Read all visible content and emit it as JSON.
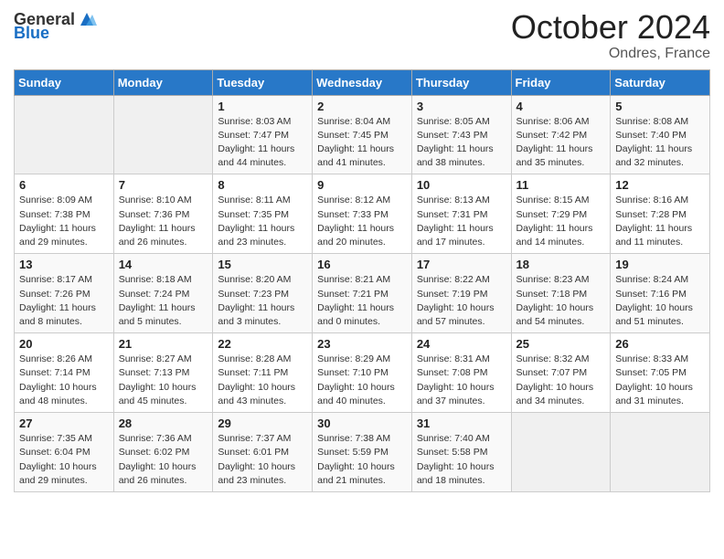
{
  "header": {
    "logo": {
      "general": "General",
      "blue": "Blue"
    },
    "month": "October 2024",
    "location": "Ondres, France"
  },
  "days_of_week": [
    "Sunday",
    "Monday",
    "Tuesday",
    "Wednesday",
    "Thursday",
    "Friday",
    "Saturday"
  ],
  "weeks": [
    [
      {
        "day": "",
        "info": ""
      },
      {
        "day": "",
        "info": ""
      },
      {
        "day": "1",
        "info": "Sunrise: 8:03 AM\nSunset: 7:47 PM\nDaylight: 11 hours and 44 minutes."
      },
      {
        "day": "2",
        "info": "Sunrise: 8:04 AM\nSunset: 7:45 PM\nDaylight: 11 hours and 41 minutes."
      },
      {
        "day": "3",
        "info": "Sunrise: 8:05 AM\nSunset: 7:43 PM\nDaylight: 11 hours and 38 minutes."
      },
      {
        "day": "4",
        "info": "Sunrise: 8:06 AM\nSunset: 7:42 PM\nDaylight: 11 hours and 35 minutes."
      },
      {
        "day": "5",
        "info": "Sunrise: 8:08 AM\nSunset: 7:40 PM\nDaylight: 11 hours and 32 minutes."
      }
    ],
    [
      {
        "day": "6",
        "info": "Sunrise: 8:09 AM\nSunset: 7:38 PM\nDaylight: 11 hours and 29 minutes."
      },
      {
        "day": "7",
        "info": "Sunrise: 8:10 AM\nSunset: 7:36 PM\nDaylight: 11 hours and 26 minutes."
      },
      {
        "day": "8",
        "info": "Sunrise: 8:11 AM\nSunset: 7:35 PM\nDaylight: 11 hours and 23 minutes."
      },
      {
        "day": "9",
        "info": "Sunrise: 8:12 AM\nSunset: 7:33 PM\nDaylight: 11 hours and 20 minutes."
      },
      {
        "day": "10",
        "info": "Sunrise: 8:13 AM\nSunset: 7:31 PM\nDaylight: 11 hours and 17 minutes."
      },
      {
        "day": "11",
        "info": "Sunrise: 8:15 AM\nSunset: 7:29 PM\nDaylight: 11 hours and 14 minutes."
      },
      {
        "day": "12",
        "info": "Sunrise: 8:16 AM\nSunset: 7:28 PM\nDaylight: 11 hours and 11 minutes."
      }
    ],
    [
      {
        "day": "13",
        "info": "Sunrise: 8:17 AM\nSunset: 7:26 PM\nDaylight: 11 hours and 8 minutes."
      },
      {
        "day": "14",
        "info": "Sunrise: 8:18 AM\nSunset: 7:24 PM\nDaylight: 11 hours and 5 minutes."
      },
      {
        "day": "15",
        "info": "Sunrise: 8:20 AM\nSunset: 7:23 PM\nDaylight: 11 hours and 3 minutes."
      },
      {
        "day": "16",
        "info": "Sunrise: 8:21 AM\nSunset: 7:21 PM\nDaylight: 11 hours and 0 minutes."
      },
      {
        "day": "17",
        "info": "Sunrise: 8:22 AM\nSunset: 7:19 PM\nDaylight: 10 hours and 57 minutes."
      },
      {
        "day": "18",
        "info": "Sunrise: 8:23 AM\nSunset: 7:18 PM\nDaylight: 10 hours and 54 minutes."
      },
      {
        "day": "19",
        "info": "Sunrise: 8:24 AM\nSunset: 7:16 PM\nDaylight: 10 hours and 51 minutes."
      }
    ],
    [
      {
        "day": "20",
        "info": "Sunrise: 8:26 AM\nSunset: 7:14 PM\nDaylight: 10 hours and 48 minutes."
      },
      {
        "day": "21",
        "info": "Sunrise: 8:27 AM\nSunset: 7:13 PM\nDaylight: 10 hours and 45 minutes."
      },
      {
        "day": "22",
        "info": "Sunrise: 8:28 AM\nSunset: 7:11 PM\nDaylight: 10 hours and 43 minutes."
      },
      {
        "day": "23",
        "info": "Sunrise: 8:29 AM\nSunset: 7:10 PM\nDaylight: 10 hours and 40 minutes."
      },
      {
        "day": "24",
        "info": "Sunrise: 8:31 AM\nSunset: 7:08 PM\nDaylight: 10 hours and 37 minutes."
      },
      {
        "day": "25",
        "info": "Sunrise: 8:32 AM\nSunset: 7:07 PM\nDaylight: 10 hours and 34 minutes."
      },
      {
        "day": "26",
        "info": "Sunrise: 8:33 AM\nSunset: 7:05 PM\nDaylight: 10 hours and 31 minutes."
      }
    ],
    [
      {
        "day": "27",
        "info": "Sunrise: 7:35 AM\nSunset: 6:04 PM\nDaylight: 10 hours and 29 minutes."
      },
      {
        "day": "28",
        "info": "Sunrise: 7:36 AM\nSunset: 6:02 PM\nDaylight: 10 hours and 26 minutes."
      },
      {
        "day": "29",
        "info": "Sunrise: 7:37 AM\nSunset: 6:01 PM\nDaylight: 10 hours and 23 minutes."
      },
      {
        "day": "30",
        "info": "Sunrise: 7:38 AM\nSunset: 5:59 PM\nDaylight: 10 hours and 21 minutes."
      },
      {
        "day": "31",
        "info": "Sunrise: 7:40 AM\nSunset: 5:58 PM\nDaylight: 10 hours and 18 minutes."
      },
      {
        "day": "",
        "info": ""
      },
      {
        "day": "",
        "info": ""
      }
    ]
  ]
}
